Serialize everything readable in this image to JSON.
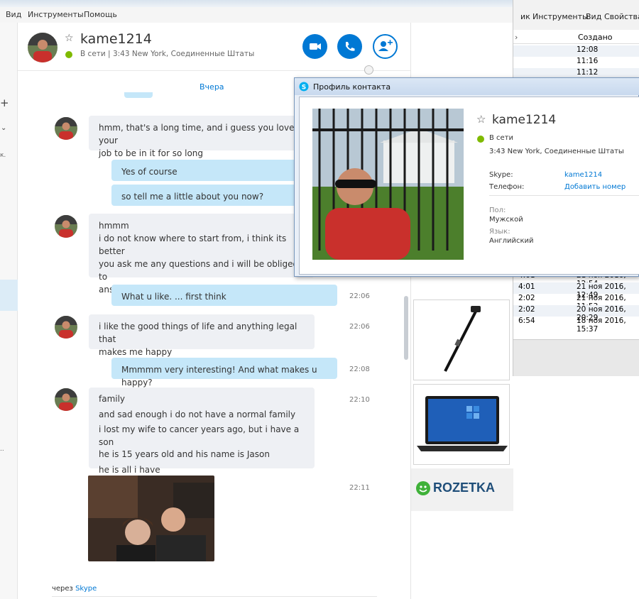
{
  "menu": {
    "view": "Вид",
    "tools": "Инструменты",
    "help": "Помощь"
  },
  "bg_window": {
    "menu_tail": "ик",
    "menu_tools": "Инструменты",
    "menu_view": "Вид",
    "menu_props": "Свойства",
    "col_created": "Создано",
    "rows": [
      {
        "a": "",
        "b": "12:08"
      },
      {
        "a": "",
        "b": "11:16"
      },
      {
        "a": "",
        "b": "11:12"
      },
      {
        "a": "4:01",
        "b": "21 ноя 2016, 12:54"
      },
      {
        "a": "4:01",
        "b": "21 ноя 2016, 12:49"
      },
      {
        "a": "2:02",
        "b": "21 ноя 2016, 11:53"
      },
      {
        "a": "2:02",
        "b": "20 ноя 2016, 20:29"
      },
      {
        "a": "6:54",
        "b": "18 ноя 2016, 15:37"
      }
    ]
  },
  "contact": {
    "name": "kame1214",
    "status": "В сети",
    "location": "3:43 New York, Соединенные Штаты"
  },
  "date_divider": "Вчера",
  "messages": [
    {
      "dir": "in",
      "lines": [
        "hmm, that's a long time, and i guess you love your",
        "job to be in it for so long"
      ]
    },
    {
      "dir": "out",
      "lines": [
        "Yes of course"
      ]
    },
    {
      "dir": "out",
      "lines": [
        "so tell me a little about you now?"
      ]
    },
    {
      "dir": "in",
      "lines": [
        "hmmm"
      ]
    },
    {
      "dir": "in",
      "lines": [
        "i do not know where to start from, i think its better",
        "you ask me any questions and i will be obliged to",
        "answer"
      ]
    },
    {
      "dir": "out",
      "lines": [
        "What u like. ... first think"
      ],
      "time": "22:06"
    },
    {
      "dir": "in",
      "lines": [
        "i like the good things of life and anything legal that",
        "makes me happy"
      ],
      "time": "22:06"
    },
    {
      "dir": "out",
      "lines": [
        "Mmmmm very interesting! And what makes u happy?"
      ],
      "time": "22:08"
    },
    {
      "dir": "in",
      "lines": [
        "family"
      ],
      "time": "22:10"
    },
    {
      "dir": "in",
      "lines": [
        "and sad enough i do not have a normal family"
      ]
    },
    {
      "dir": "in",
      "lines": [
        "i lost my wife to cancer years ago, but i have a son",
        "he is 15 years old and his name is Jason"
      ]
    },
    {
      "dir": "in",
      "lines": [
        "he is all i have"
      ]
    }
  ],
  "photo_time": "22:11",
  "footer": {
    "via": "через",
    "skype": "Skype"
  },
  "ad_brand": "ROZETKA",
  "profile": {
    "title": "Профиль контакта",
    "name": "kame1214",
    "status": "В сети",
    "location": "3:43 New York, Соединенные Штаты",
    "skype_label": "Skype:",
    "skype_value": "kame1214",
    "phone_label": "Телефон:",
    "phone_value": "Добавить номер",
    "gender_label": "Пол:",
    "gender_value": "Мужской",
    "lang_label": "Язык:",
    "lang_value": "Английский"
  },
  "colors": {
    "accent": "#00aff0",
    "button": "#0078d4",
    "online": "#7fba00",
    "bubble_out": "#c5e7f9",
    "bubble_in": "#eef0f4"
  }
}
